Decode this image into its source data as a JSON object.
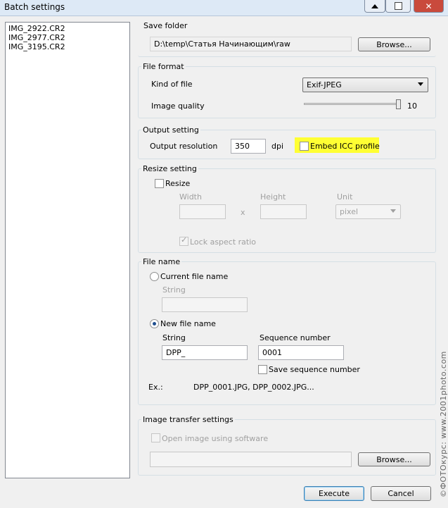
{
  "window": {
    "title": "Batch settings",
    "close_glyph": "✕"
  },
  "file_list": [
    "IMG_2922.CR2",
    "IMG_2977.CR2",
    "IMG_3195.CR2"
  ],
  "save_folder": {
    "group_label": "Save folder",
    "path": "D:\\temp\\Статья Начинающим\\raw",
    "browse_label": "Browse..."
  },
  "file_format": {
    "group_label": "File format",
    "kind_label": "Kind of file",
    "kind_value": "Exif-JPEG",
    "quality_label": "Image quality",
    "quality_value": "10"
  },
  "output": {
    "group_label": "Output setting",
    "resolution_label": "Output resolution",
    "resolution_value": "350",
    "unit": "dpi",
    "embed_icc_label": "Embed ICC profile",
    "highlight_color": "#ffff33"
  },
  "resize": {
    "group_label": "Resize setting",
    "resize_label": "Resize",
    "width_label": "Width",
    "height_label": "Height",
    "unit_label": "Unit",
    "separator": "x",
    "unit_value": "pixel",
    "lock_label": "Lock aspect ratio"
  },
  "file_name": {
    "group_label": "File name",
    "current_label": "Current file name",
    "current_string_label": "String",
    "new_label": "New file name",
    "string_label": "String",
    "string_value": "DPP_",
    "sequence_label": "Sequence number",
    "sequence_value": "0001",
    "save_sequence_label": "Save sequence number",
    "example_label": "Ex.:",
    "example_value": "DPP_0001.JPG, DPP_0002.JPG..."
  },
  "transfer": {
    "group_label": "Image transfer settings",
    "open_label": "Open image using software",
    "browse_label": "Browse..."
  },
  "actions": {
    "execute_label": "Execute",
    "cancel_label": "Cancel"
  },
  "watermark": "©ФОТОкурс: www.2001photo.com"
}
